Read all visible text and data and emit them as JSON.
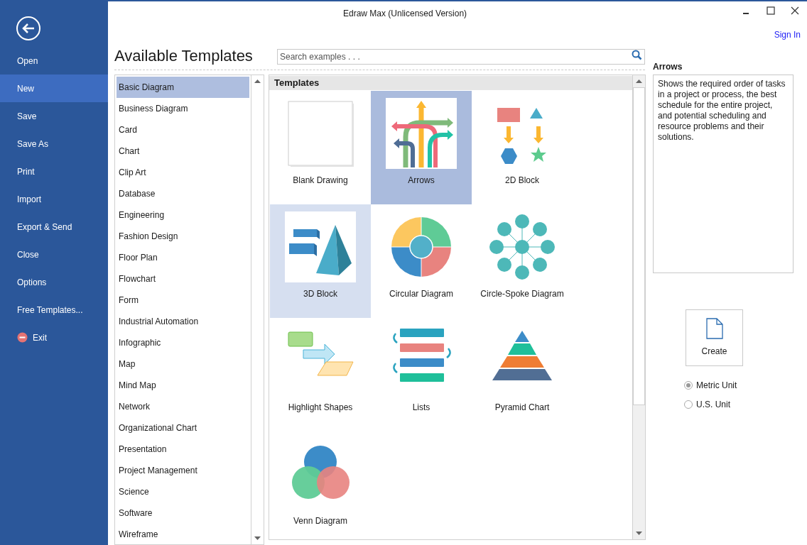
{
  "window": {
    "title": "Edraw Max (Unlicensed Version)"
  },
  "sign_in": "Sign In",
  "sidebar": {
    "items": [
      {
        "label": "Open",
        "kind": "item",
        "selected": false
      },
      {
        "label": "New",
        "kind": "item",
        "selected": true
      },
      {
        "label": "Save",
        "kind": "item",
        "selected": false
      },
      {
        "label": "Save As",
        "kind": "item",
        "selected": false
      },
      {
        "label": "Print",
        "kind": "item",
        "selected": false
      },
      {
        "label": "Import",
        "kind": "item",
        "selected": false
      },
      {
        "label": "Export & Send",
        "kind": "item",
        "selected": false
      },
      {
        "label": "Close",
        "kind": "item",
        "selected": false
      },
      {
        "label": "Options",
        "kind": "item",
        "selected": false
      },
      {
        "label": "Free Templates...",
        "kind": "item",
        "selected": false
      },
      {
        "label": "Exit",
        "kind": "exit",
        "selected": false
      }
    ]
  },
  "heading": "Available Templates",
  "search": {
    "placeholder": "Search examples . . ."
  },
  "categories": [
    {
      "label": "Basic Diagram",
      "selected": true
    },
    {
      "label": "Business Diagram",
      "selected": false
    },
    {
      "label": "Card",
      "selected": false
    },
    {
      "label": "Chart",
      "selected": false
    },
    {
      "label": "Clip Art",
      "selected": false
    },
    {
      "label": "Database",
      "selected": false
    },
    {
      "label": "Engineering",
      "selected": false
    },
    {
      "label": "Fashion Design",
      "selected": false
    },
    {
      "label": "Floor Plan",
      "selected": false
    },
    {
      "label": "Flowchart",
      "selected": false
    },
    {
      "label": "Form",
      "selected": false
    },
    {
      "label": "Industrial Automation",
      "selected": false
    },
    {
      "label": "Infographic",
      "selected": false
    },
    {
      "label": "Map",
      "selected": false
    },
    {
      "label": "Mind Map",
      "selected": false
    },
    {
      "label": "Network",
      "selected": false
    },
    {
      "label": "Organizational Chart",
      "selected": false
    },
    {
      "label": "Presentation",
      "selected": false
    },
    {
      "label": "Project Management",
      "selected": false
    },
    {
      "label": "Science",
      "selected": false
    },
    {
      "label": "Software",
      "selected": false
    },
    {
      "label": "Wireframe",
      "selected": false
    }
  ],
  "templates": {
    "header": "Templates",
    "items": [
      {
        "label": "Blank Drawing",
        "kind": "blank",
        "selected": false,
        "hovered": false
      },
      {
        "label": "Arrows",
        "kind": "arrows",
        "selected": true,
        "hovered": false
      },
      {
        "label": "2D Block",
        "kind": "block2d",
        "selected": false,
        "hovered": false
      },
      {
        "label": "3D Block",
        "kind": "block3d",
        "selected": false,
        "hovered": true
      },
      {
        "label": "Circular Diagram",
        "kind": "circular",
        "selected": false,
        "hovered": false
      },
      {
        "label": "Circle-Spoke Diagram",
        "kind": "spoke",
        "selected": false,
        "hovered": false
      },
      {
        "label": "Highlight Shapes",
        "kind": "highlight",
        "selected": false,
        "hovered": false
      },
      {
        "label": "Lists",
        "kind": "lists",
        "selected": false,
        "hovered": false
      },
      {
        "label": "Pyramid Chart",
        "kind": "pyramid",
        "selected": false,
        "hovered": false
      },
      {
        "label": "Venn Diagram",
        "kind": "venn",
        "selected": false,
        "hovered": false
      }
    ]
  },
  "details": {
    "title": "Arrows",
    "description": "Shows the required order of tasks in a project or process, the best schedule for the entire project, and potential scheduling and resource problems and their solutions."
  },
  "create_button": "Create",
  "units": [
    {
      "label": "Metric Unit",
      "selected": true
    },
    {
      "label": "U.S. Unit",
      "selected": false
    }
  ]
}
